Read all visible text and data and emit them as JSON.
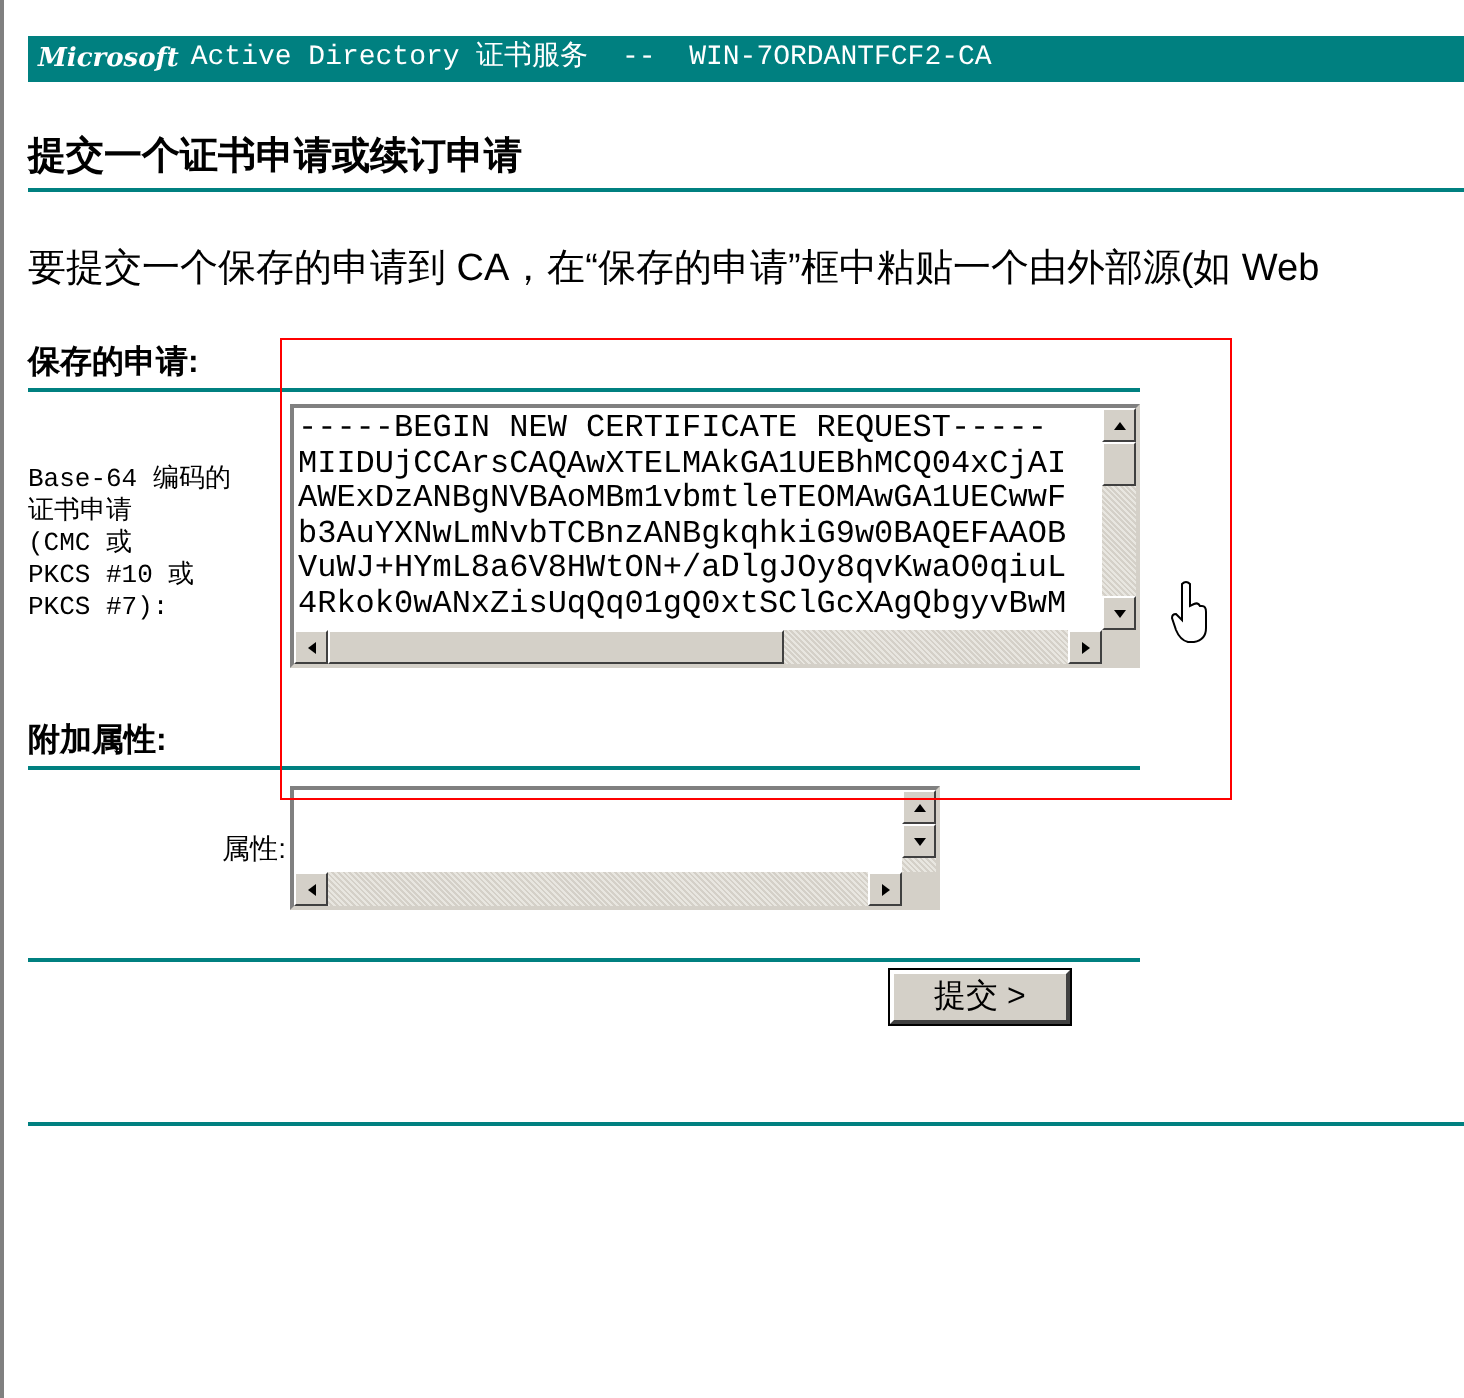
{
  "header": {
    "brand": "Microsoft",
    "title": "Active Directory 证书服务  --  WIN-7ORDANTFCF2-CA"
  },
  "page_title": "提交一个证书申请或续订申请",
  "intro": "要提交一个保存的申请到 CA，在“保存的申请”框中粘贴一个由外部源(如 Web",
  "saved_request": {
    "heading": "保存的申请:",
    "label_lines": [
      "Base-64 编码的",
      "证书申请",
      "(CMC 或",
      "PKCS #10 或",
      "PKCS #7):"
    ],
    "lines": [
      "-----BEGIN NEW CERTIFICATE REQUEST-----",
      "MIIDUjCCArsCAQAwXTELMAkGA1UEBhMCQ04xCjAI",
      "AWExDzANBgNVBAoMBm1vbmtleTEOMAwGA1UECwwF",
      "b3AuYXNwLmNvbTCBnzANBgkqhkiG9w0BAQEFAAOB",
      "VuWJ+HYmL8a6V8HWtON+/aDlgJOy8qvKwaO0qiuL",
      "4Rkok0wANxZisUqQq01gQ0xtSClGcXAgQbgyvBwM"
    ]
  },
  "attributes": {
    "heading": "附加属性:",
    "label": "属性:"
  },
  "submit_button": "提交 >"
}
